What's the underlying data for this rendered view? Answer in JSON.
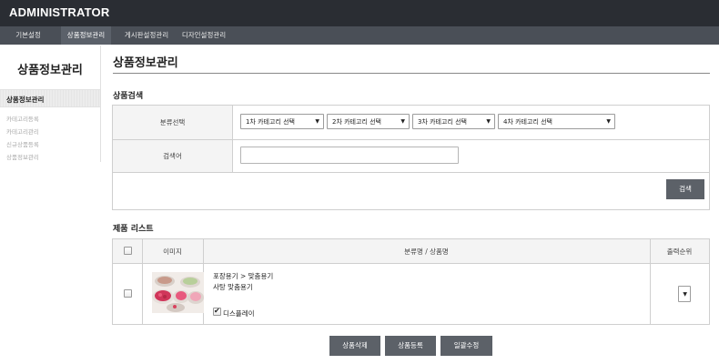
{
  "app": {
    "title": "ADMINISTRATOR"
  },
  "nav": {
    "tabs": [
      {
        "label": "기본설정"
      },
      {
        "label": "상품정보관리"
      },
      {
        "label": "게시판설정관리"
      },
      {
        "label": "디자인설정관리"
      }
    ]
  },
  "sidebar": {
    "title": "상품정보관리",
    "section": "상품정보관리",
    "items": [
      {
        "label": "카테고리등록"
      },
      {
        "label": "카테고리관리"
      },
      {
        "label": "신규상품등록"
      },
      {
        "label": "상품정보관리"
      }
    ]
  },
  "main": {
    "title": "상품정보관리",
    "search": {
      "heading": "상품검색",
      "category_label": "분류선택",
      "keyword_label": "검색어",
      "selects": [
        {
          "value": "1차 카테고리 선택"
        },
        {
          "value": "2차 카테고리 선택"
        },
        {
          "value": "3차 카테고리 선택"
        },
        {
          "value": "4차 카테고리 선택"
        }
      ],
      "keyword_value": "",
      "search_button": "검색"
    },
    "list": {
      "heading": "제품 리스트",
      "columns": {
        "image": "이미지",
        "category_name": "분류명 / 상품명",
        "order": "출력순위"
      },
      "rows": [
        {
          "category": "포장용기 > 맞춤용기",
          "name": "사탕 맞춤용기",
          "display_label": "디스플레이",
          "display_checked": true,
          "order_value": ""
        }
      ]
    },
    "actions": {
      "delete": "상품삭제",
      "register": "상품등록",
      "bulk_edit": "일괄수정"
    }
  },
  "colors": {
    "topbar": "#2a2d33",
    "navbar": "#4a4f57",
    "button": "#5c6168"
  }
}
